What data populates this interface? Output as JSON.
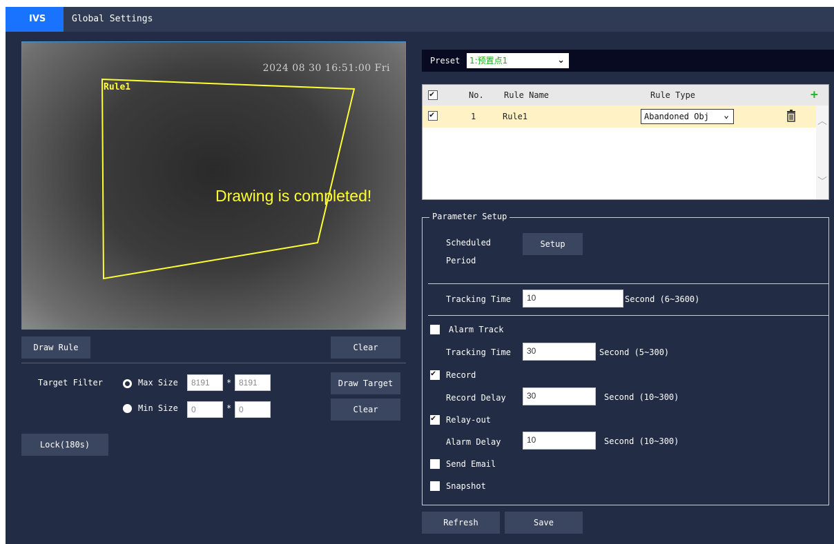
{
  "tabs": [
    {
      "label": "IVS",
      "active": true
    },
    {
      "label": "Global Settings",
      "active": false
    }
  ],
  "video": {
    "timestamp": "2024 08 30 16:51:00 Fri",
    "message": "Drawing is completed!",
    "rule_label": "Rule1",
    "rule_color": "#ffff33"
  },
  "left_controls": {
    "draw_rule": "Draw Rule",
    "clear": "Clear",
    "target_filter_label": "Target Filter",
    "max_size_label": "Max Size",
    "max_w": "8191",
    "max_h": "8191",
    "min_size_label": "Min Size",
    "min_w": "0",
    "min_h": "0",
    "separator": "*",
    "draw_target": "Draw Target",
    "clear_target": "Clear",
    "lock": "Lock(180s)",
    "selected_size": "Max Size"
  },
  "preset": {
    "label": "Preset",
    "value": "1:预置点1"
  },
  "rules_table": {
    "headers": {
      "no": "No.",
      "name": "Rule Name",
      "type": "Rule Type"
    },
    "add_icon": "+",
    "rows": [
      {
        "checked": true,
        "no": "1",
        "name": "Rule1",
        "type": "Abandoned Obj"
      }
    ],
    "header_checked": true
  },
  "params": {
    "legend": "Parameter Setup",
    "scheduled_period_line1": "Scheduled",
    "scheduled_period_line2": "Period",
    "setup": "Setup",
    "tracking_time_label": "Tracking Time",
    "tracking_time_value": "10",
    "tracking_time_hint": "Second (6~3600)",
    "alarm_track": {
      "label": "Alarm Track",
      "checked": false
    },
    "alarm_tracking_time_label": "Tracking Time",
    "alarm_tracking_time_value": "30",
    "alarm_tracking_time_hint": "Second (5~300)",
    "record": {
      "label": "Record",
      "checked": true
    },
    "record_delay_label": "Record Delay",
    "record_delay_value": "30",
    "record_delay_hint": "Second (10~300)",
    "relay_out": {
      "label": "Relay-out",
      "checked": true
    },
    "alarm_delay_label": "Alarm Delay",
    "alarm_delay_value": "10",
    "alarm_delay_hint": "Second (10~300)",
    "send_email": {
      "label": "Send Email",
      "checked": false
    },
    "snapshot": {
      "label": "Snapshot",
      "checked": false
    }
  },
  "footer": {
    "refresh": "Refresh",
    "save": "Save"
  },
  "colors": {
    "background": "#222c44",
    "tabbar": "#2f3a55",
    "active_tab": "#1a73ff",
    "button": "#3a4560",
    "highlight_row": "#fff2c4",
    "add_icon": "#2ab52a"
  }
}
